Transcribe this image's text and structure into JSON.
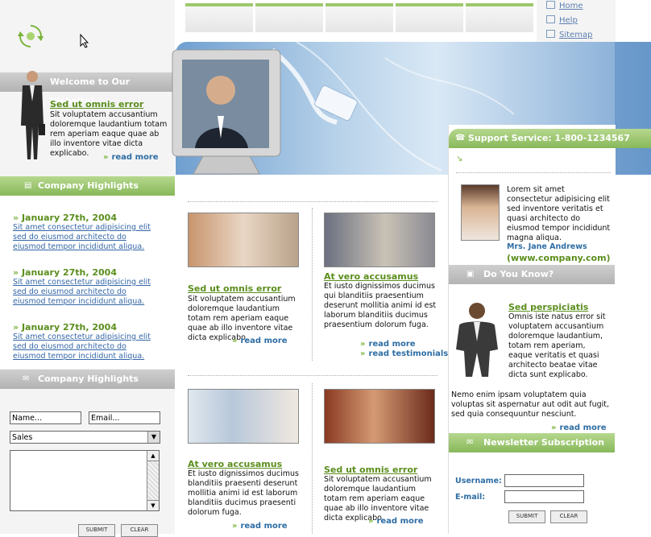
{
  "nav": {
    "links": [
      "Home",
      "Help",
      "Sitemap"
    ]
  },
  "welcome": {
    "title": "Welcome to Our Website!",
    "heading": "Sed ut omnis error",
    "body": "Sit voluptatem accusantium doloremque laudantium totam rem aperiam eaque quae ab illo inventore vitae dicta explicabo.",
    "more": "read more"
  },
  "highlights": {
    "title": "Company Highlights",
    "items": [
      {
        "date": "January 27th, 2004",
        "text": "Sit amet consectetur adipisicing elit sed do eiusmod architecto do eiusmod tempor incididunt aliqua."
      },
      {
        "date": "January 27th, 2004",
        "text": "Sit amet consectetur adipisicing elit sed do eiusmod architecto do eiusmod tempor incididunt aliqua."
      },
      {
        "date": "January 27th, 2004",
        "text": "Sit amet consectetur adipisicing elit sed do eiusmod architecto do eiusmod tempor incididunt aliqua."
      }
    ]
  },
  "contact": {
    "title": "Company Highlights",
    "name_value": "Name...",
    "email_value": "Email...",
    "select_value": "Sales",
    "submit": "SUBMIT",
    "clear": "CLEAR"
  },
  "support": {
    "title": "Support Service: 1-800-1234567",
    "body": "Lorem sit amet consectetur adipisicing elit sed inventore veritatis et quasi architecto do eiusmod tempor incididunt magna aliqua.",
    "name": "Mrs. Jane Andrews",
    "site": "(www.company.com)"
  },
  "know": {
    "title": "Do You Know?",
    "heading": "Sed perspiciatis",
    "body": "Omnis iste natus error sit voluptatem accusantium doloremque laudantium, totam rem aperiam, eaque veritatis et quasi architecto beatae vitae dicta sunt explicabo.",
    "body2": "Nemo enim ipsam voluptatem quia voluptas sit aspernatur aut odit aut fugit, sed quia consequuntur nesciunt.",
    "more": "read more"
  },
  "newsletter": {
    "title": "Newsletter Subscription",
    "username_label": "Username:",
    "email_label": "E-mail:",
    "submit": "SUBMIT",
    "clear": "CLEAR"
  },
  "articles": [
    {
      "heading": "Sed ut omnis error",
      "body": "Sit voluptatem accusantium doloremque laudantium totam rem aperiam eaque quae ab illo inventore vitae dicta explicabo.",
      "more": "read more"
    },
    {
      "heading": "At vero accusamus",
      "body": "Et iusto dignissimos ducimus qui blanditiis praesentium deserunt mollitia animi id est laborum blanditiis ducimus praesentium dolorum fuga.",
      "more": "read more",
      "more2": "read testimonials"
    },
    {
      "heading": "At vero accusamus",
      "body": "Et iusto dignissimos ducimus blanditiis praesenti deserunt mollitia animi id est laborum blanditiis ducimus praesenti dolorum fuga.",
      "more": "read more"
    },
    {
      "heading": "Sed ut omnis error",
      "body": "Sit voluptatem accusantium doloremque laudantium totam rem aperiam eaque quae ab illo inventore vitae dicta explicabo.",
      "more": "read more"
    }
  ],
  "colors": {
    "accent_green": "#5b8e1d",
    "bar_green": "#9ec86c",
    "link_blue": "#2e6da4"
  }
}
